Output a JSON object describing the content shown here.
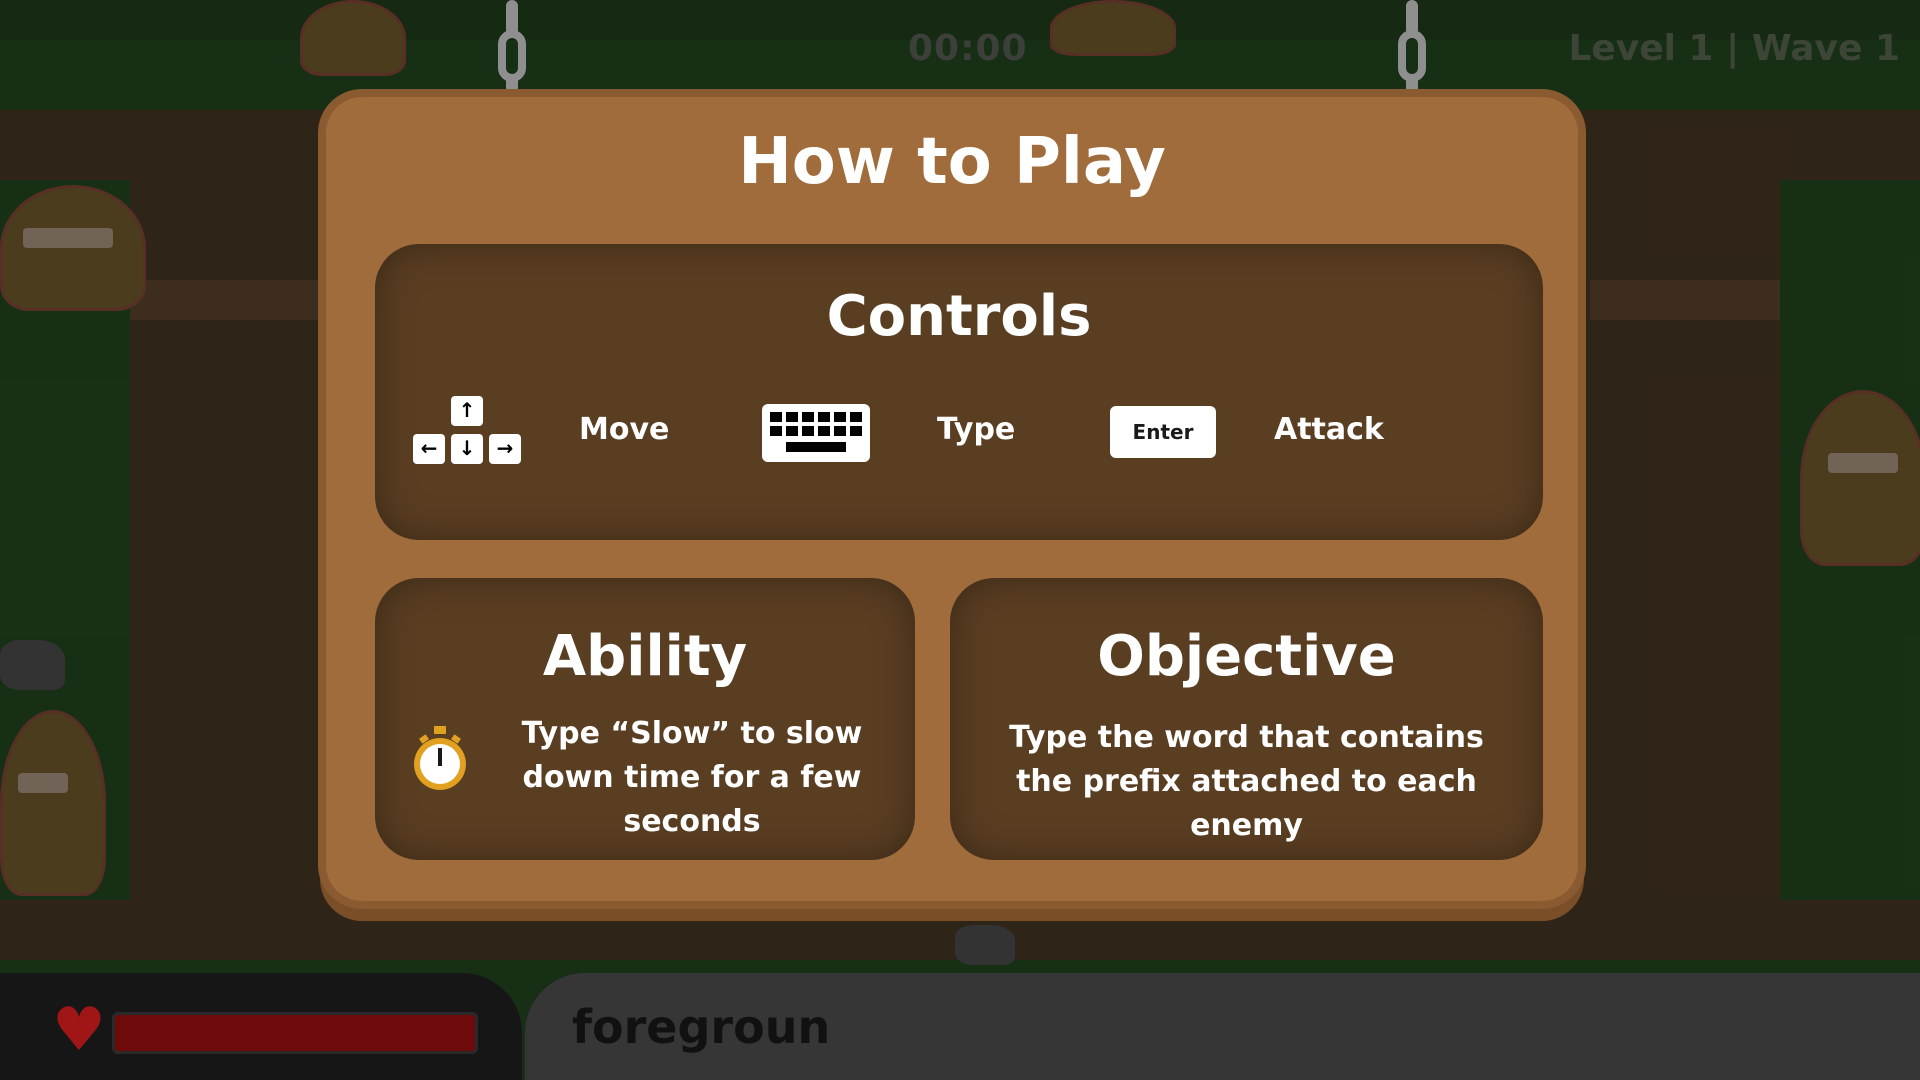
{
  "hud": {
    "timer": "00:00",
    "level_wave": "Level 1 | Wave 1",
    "typed_text": "foregroun",
    "health_fraction": 1.0
  },
  "board": {
    "title": "How to Play",
    "controls": {
      "title": "Controls",
      "move_label": "Move",
      "type_label": "Type",
      "enter_key": "Enter",
      "attack_label": "Attack",
      "arrow_up": "↑",
      "arrow_left": "←",
      "arrow_down": "↓",
      "arrow_right": "→"
    },
    "ability": {
      "title": "Ability",
      "description": "Type “Slow” to slow down time for a few seconds"
    },
    "objective": {
      "title": "Objective",
      "description": "Type the word that contains the prefix attached to each enemy"
    }
  },
  "icons": [
    "arrow-keys-icon",
    "keyboard-icon",
    "stopwatch-icon",
    "heart-icon",
    "chain-icon"
  ],
  "colors": {
    "board": "#a06c3c",
    "panel": "#5a3e22",
    "health": "#6e0a0a",
    "heart": "#a01616"
  }
}
